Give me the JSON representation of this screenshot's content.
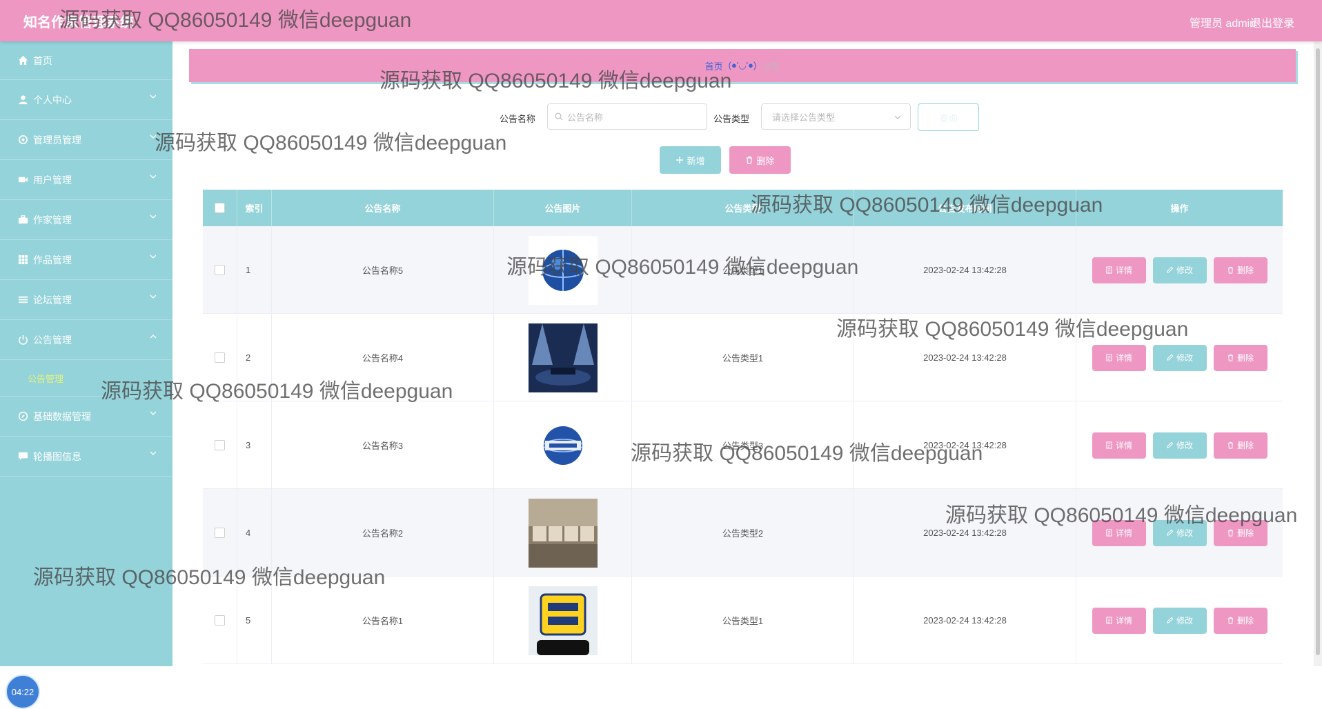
{
  "header": {
    "title": "知名作家管理系统",
    "admin_label": "管理员 admin",
    "logout": "退出登录"
  },
  "sidebar": {
    "items": [
      {
        "label": "首页",
        "icon": "home-icon"
      },
      {
        "label": "个人中心",
        "icon": "user-icon"
      },
      {
        "label": "管理员管理",
        "icon": "settings-icon"
      },
      {
        "label": "用户管理",
        "icon": "video-icon"
      },
      {
        "label": "作家管理",
        "icon": "briefcase-icon"
      },
      {
        "label": "作品管理",
        "icon": "grid-icon"
      },
      {
        "label": "论坛管理",
        "icon": "list-icon"
      },
      {
        "label": "公告管理",
        "icon": "power-icon"
      },
      {
        "label": "基础数据管理",
        "icon": "compass-icon"
      },
      {
        "label": "轮播图信息",
        "icon": "message-icon"
      }
    ],
    "submenu_label": "公告管理",
    "clock": "04:22"
  },
  "breadcrumb": {
    "home": "首页",
    "separator": "(●'◡'●)",
    "current": "公告"
  },
  "search": {
    "name_label": "公告名称",
    "name_placeholder": "公告名称",
    "type_label": "公告类型",
    "type_placeholder": "请选择公告类型",
    "query_button": "查询"
  },
  "actions": {
    "add": "新增",
    "delete": "删除"
  },
  "table": {
    "headers": [
      "索引",
      "公告名称",
      "公告图片",
      "公告类型",
      "公告发布时间",
      "操作"
    ],
    "rows": [
      {
        "index": "1",
        "name": "公告名称5",
        "type": "公告类型1",
        "time": "2023-02-24 13:42:28",
        "image": "globe-news"
      },
      {
        "index": "2",
        "name": "公告名称4",
        "type": "公告类型1",
        "time": "2023-02-24 13:42:28",
        "image": "stage-news"
      },
      {
        "index": "3",
        "name": "公告名称3",
        "type": "公告类型3",
        "time": "2023-02-24 13:42:28",
        "image": "news-globe"
      },
      {
        "index": "4",
        "name": "公告名称2",
        "type": "公告类型2",
        "time": "2023-02-24 13:42:28",
        "image": "news-blocks"
      },
      {
        "index": "5",
        "name": "公告名称1",
        "type": "公告类型1",
        "time": "2023-02-24 13:42:28",
        "image": "hot-news"
      }
    ],
    "row_actions": {
      "detail": "详情",
      "edit": "修改",
      "delete": "删除"
    }
  },
  "watermark": "源码获取 QQ86050149 微信deepguan",
  "colors": {
    "pink": "#ef97c3",
    "teal": "#95d3da",
    "link": "#3f5fd9",
    "submenu": "#e6f37a"
  }
}
